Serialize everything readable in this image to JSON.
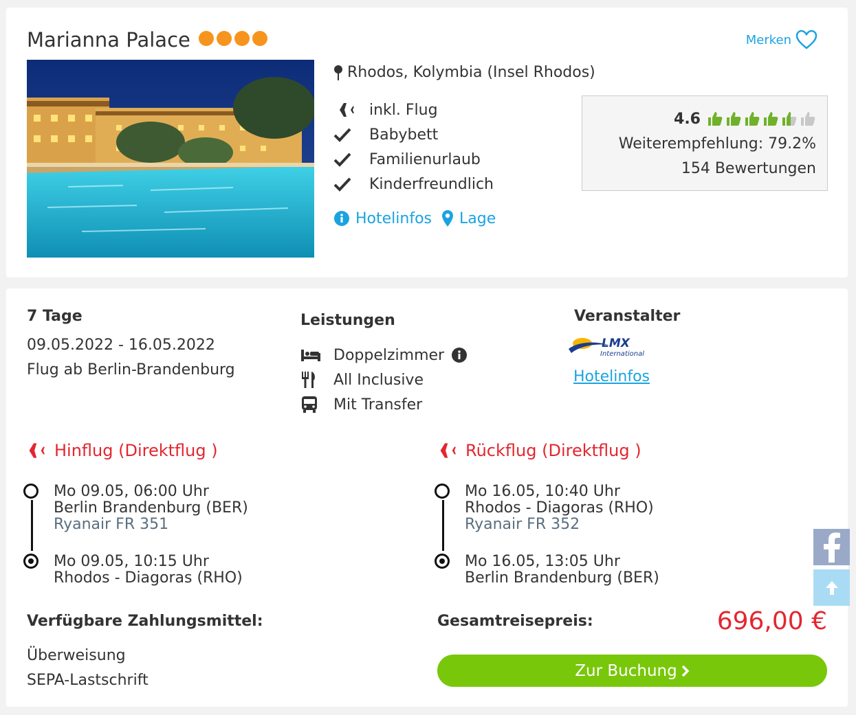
{
  "hotel": {
    "name": "Marianna Palace",
    "stars": 4,
    "merken_label": "Merken",
    "location": "Rhodos, Kolymbia (Insel Rhodos)",
    "features": [
      "inkl. Flug",
      "Babybett",
      "Familienurlaub",
      "Kinderfreundlich"
    ],
    "links": {
      "hotelinfos": "Hotelinfos",
      "lage": "Lage"
    },
    "rating": {
      "score": "4.6",
      "thumbs_score": 4.6,
      "recommendation": "Weiterempfehlung: 79.2%",
      "reviews": "154 Bewertungen"
    }
  },
  "offer": {
    "duration": "7 Tage",
    "dates": "09.05.2022 - 16.05.2022",
    "departure": "Flug ab Berlin-Brandenburg",
    "leistungen_title": "Leistungen",
    "leistungen": {
      "room": "Doppelzimmer",
      "board": "All Inclusive",
      "transfer": "Mit Transfer"
    },
    "veranstalter_title": "Veranstalter",
    "veranstalter_link": "Hotelinfos",
    "outbound": {
      "title": "Hinflug (Direktflug )",
      "dep_time": "Mo 09.05, 06:00 Uhr",
      "dep_airport": "Berlin Brandenburg (BER)",
      "airline": "Ryanair FR 351",
      "arr_time": "Mo 09.05, 10:15 Uhr",
      "arr_airport": "Rhodos - Diagoras (RHO)"
    },
    "return": {
      "title": "Rückflug (Direktflug )",
      "dep_time": "Mo 16.05, 10:40 Uhr",
      "dep_airport": "Rhodos - Diagoras (RHO)",
      "airline": "Ryanair FR 352",
      "arr_time": "Mo 16.05, 13:05 Uhr",
      "arr_airport": "Berlin Brandenburg (BER)"
    },
    "payment_title": "Verfügbare Zahlungsmittel:",
    "payments": [
      "Überweisung",
      "SEPA-Lastschrift"
    ],
    "price_label": "Gesamtreisepreis:",
    "price": "696,00 €",
    "book_label": "Zur Buchung"
  },
  "colors": {
    "accent_blue": "#1ba3e0",
    "star_orange": "#f7941d",
    "flight_red": "#e3262f",
    "book_green": "#79c70a",
    "thumb_green": "#6fb22a"
  },
  "icons": {
    "star": "star-icon",
    "heart": "heart-icon",
    "map_pin": "map-pin-icon",
    "plane": "plane-icon",
    "check": "check-icon",
    "info": "info-icon",
    "location": "location-icon",
    "thumb": "thumbs-up-icon",
    "bed": "bed-icon",
    "cutlery": "cutlery-icon",
    "bus": "bus-icon",
    "facebook": "facebook-icon",
    "arrow_up": "arrow-up-icon"
  }
}
